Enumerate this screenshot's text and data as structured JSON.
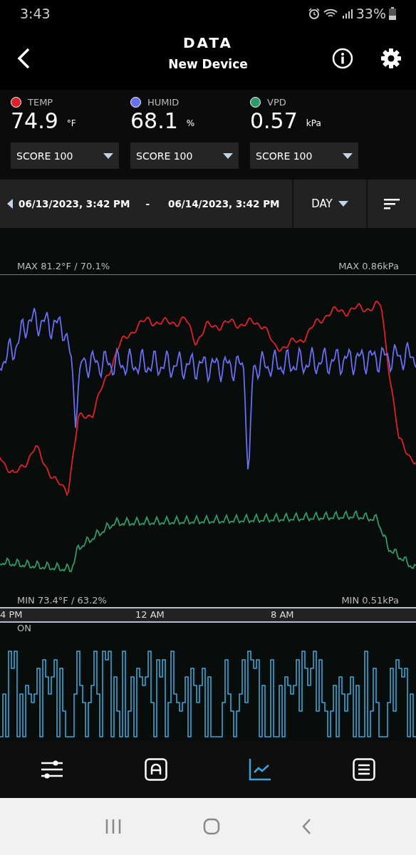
{
  "status_bar": {
    "time": "3:43",
    "battery": "33%"
  },
  "header": {
    "title": "DATA",
    "subtitle": "New Device"
  },
  "sensors": [
    {
      "label": "TEMP",
      "value": "74.9",
      "unit": "°F",
      "color": "#e0202a",
      "dropdown": "SCORE 100"
    },
    {
      "label": "HUMID",
      "value": "68.1",
      "unit": "%",
      "color": "#6a6ef0",
      "dropdown": "SCORE 100"
    },
    {
      "label": "VPD",
      "value": "0.57",
      "unit": "kPa",
      "color": "#2e9a6a",
      "dropdown": "SCORE 100"
    }
  ],
  "date_range": {
    "start": "06/13/2023, 3:42 PM",
    "separator": "-",
    "end": "06/14/2023, 3:42 PM",
    "period": "DAY"
  },
  "chart": {
    "max_left": "MAX 81.2°F / 70.1%",
    "max_right": "MAX 0.86kPa",
    "min_left": "MIN 73.4°F / 63.2%",
    "min_right": "MIN 0.51kPa",
    "time_ticks": [
      "4 PM",
      "12 AM",
      "8 AM"
    ]
  },
  "switch_chart": {
    "label": "ON"
  },
  "bottom_nav": [
    {
      "kind": "sliders",
      "selected": false
    },
    {
      "kind": "auto",
      "selected": false
    },
    {
      "kind": "chart",
      "selected": true
    },
    {
      "kind": "list",
      "selected": false
    }
  ]
}
